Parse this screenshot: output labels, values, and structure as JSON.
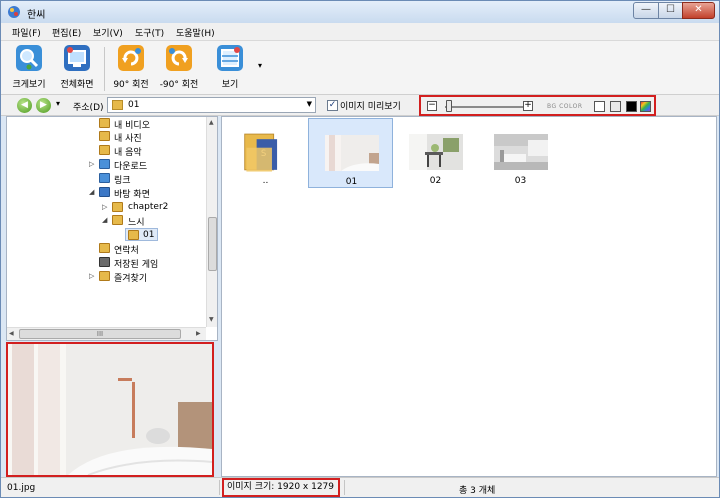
{
  "window": {
    "title": "한씨",
    "controls": {
      "minimize": "—",
      "maximize": "☐",
      "close": "✕"
    }
  },
  "menu": [
    {
      "label": "파일(F)"
    },
    {
      "label": "편집(E)"
    },
    {
      "label": "보기(V)"
    },
    {
      "label": "도구(T)"
    },
    {
      "label": "도움말(H)"
    }
  ],
  "toolbar": {
    "buttons": [
      {
        "label": "크게보기",
        "icon": "magnify-icon",
        "color": "#3a8fd8"
      },
      {
        "label": "전체화면",
        "icon": "fullscreen-icon",
        "color": "#2f6fc0"
      },
      {
        "label": "90° 회전",
        "icon": "rotate-cw-icon",
        "color": "#f0a020"
      },
      {
        "label": "-90° 회전",
        "icon": "rotate-ccw-icon",
        "color": "#f0a020"
      },
      {
        "label": "보기",
        "icon": "view-icon",
        "color": "#3a8fd8"
      }
    ],
    "more": "▾"
  },
  "address": {
    "back": "◀",
    "forward": "▶",
    "history": "▾",
    "label": "주소(D)",
    "value": "01",
    "dropdown": "▼"
  },
  "preview_toggle": {
    "label": "이미지 미리보기",
    "checked": true,
    "mark": "✓"
  },
  "zoom": {
    "minus": "−",
    "plus": "+",
    "level": 0.05
  },
  "bg_color": {
    "label": "BG COLOR",
    "swatches": [
      "#ffffff",
      "#e9e9e9",
      "#000000",
      "multicolor"
    ]
  },
  "tree": {
    "items": [
      {
        "label": "내 비디오",
        "icon": "video-folder-icon",
        "expander": ""
      },
      {
        "label": "내 사진",
        "icon": "pictures-folder-icon",
        "expander": ""
      },
      {
        "label": "내 음악",
        "icon": "music-folder-icon",
        "expander": ""
      },
      {
        "label": "다운로드",
        "icon": "downloads-folder-icon",
        "expander": "▷"
      },
      {
        "label": "링크",
        "icon": "links-folder-icon",
        "expander": ""
      },
      {
        "label": "바탕 화면",
        "icon": "desktop-folder-icon",
        "expander": "◢"
      },
      {
        "label": "chapter2",
        "icon": "folder-icon",
        "expander": "▷"
      },
      {
        "label": "느시",
        "icon": "folder-icon",
        "expander": "◢"
      },
      {
        "label": "01",
        "icon": "folder-icon",
        "expander": "",
        "selected": true
      },
      {
        "label": "연락처",
        "icon": "contacts-folder-icon",
        "expander": ""
      },
      {
        "label": "저장된 게임",
        "icon": "games-folder-icon",
        "expander": ""
      },
      {
        "label": "즐겨찾기",
        "icon": "favorites-folder-icon",
        "expander": "▷"
      }
    ],
    "scroll": {
      "up": "▲",
      "down": "▼",
      "left": "◀",
      "right": "▶",
      "grip": "III"
    }
  },
  "files": [
    {
      "name": "..",
      "kind": "parent-folder",
      "selected": false
    },
    {
      "name": "01",
      "kind": "image",
      "selected": true
    },
    {
      "name": "02",
      "kind": "image",
      "selected": false
    },
    {
      "name": "03",
      "kind": "image",
      "selected": false
    }
  ],
  "status": {
    "filename": "01.jpg",
    "image_size": "이미지 크기: 1920 x 1279",
    "count": "총 3 개체"
  }
}
